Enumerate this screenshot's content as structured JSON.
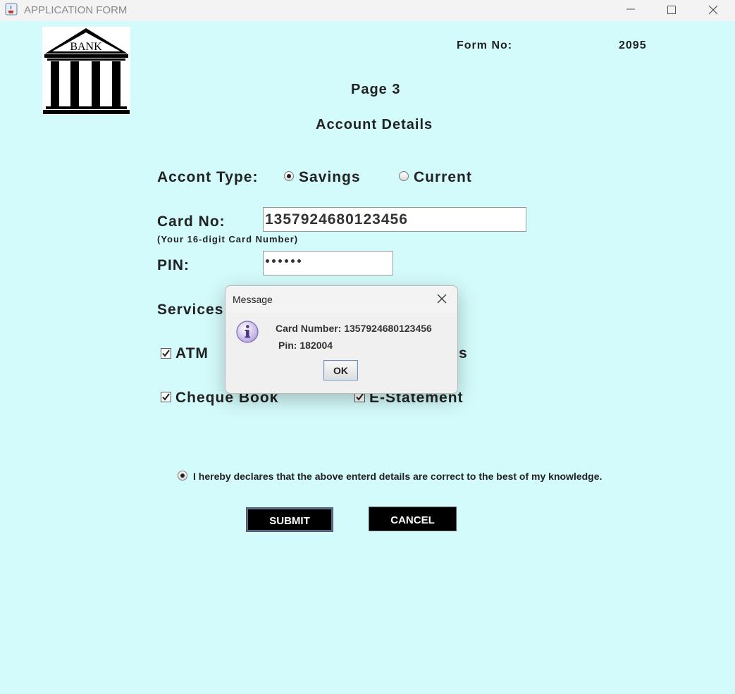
{
  "window": {
    "title": "APPLICATION FORM"
  },
  "header": {
    "logo_text": "BANK",
    "form_no_label": "Form No:",
    "form_no_value": "2095",
    "page_title": "Page 3",
    "section_title": "Account Details"
  },
  "account_type": {
    "label": "Accont Type:",
    "options": [
      {
        "label": "Savings",
        "selected": true
      },
      {
        "label": "Current",
        "selected": false
      }
    ]
  },
  "card": {
    "label": "Card No:",
    "value": "1357924680123456",
    "hint": "(Your 16-digit Card Number)"
  },
  "pin": {
    "label": "PIN:",
    "masked_length": 6
  },
  "services": {
    "label": "Services",
    "items": [
      {
        "label": "ATM",
        "checked": true
      },
      {
        "label": "ts",
        "checked": true
      },
      {
        "label": "Cheque Book",
        "checked": true
      },
      {
        "label": "E-Statement",
        "checked": true
      }
    ]
  },
  "declaration": {
    "text": "I hereby declares that the above enterd details are correct to the best of my knowledge.",
    "selected": true
  },
  "buttons": {
    "submit": "SUBMIT",
    "cancel": "CANCEL"
  },
  "dialog": {
    "title": "Message",
    "line1": "Card Number: 1357924680123456",
    "line2": "Pin: 182004",
    "ok": "OK",
    "icon": "info-icon"
  },
  "colors": {
    "background": "#d4fbfb",
    "button_bg": "#000000",
    "button_text": "#ffffff"
  }
}
